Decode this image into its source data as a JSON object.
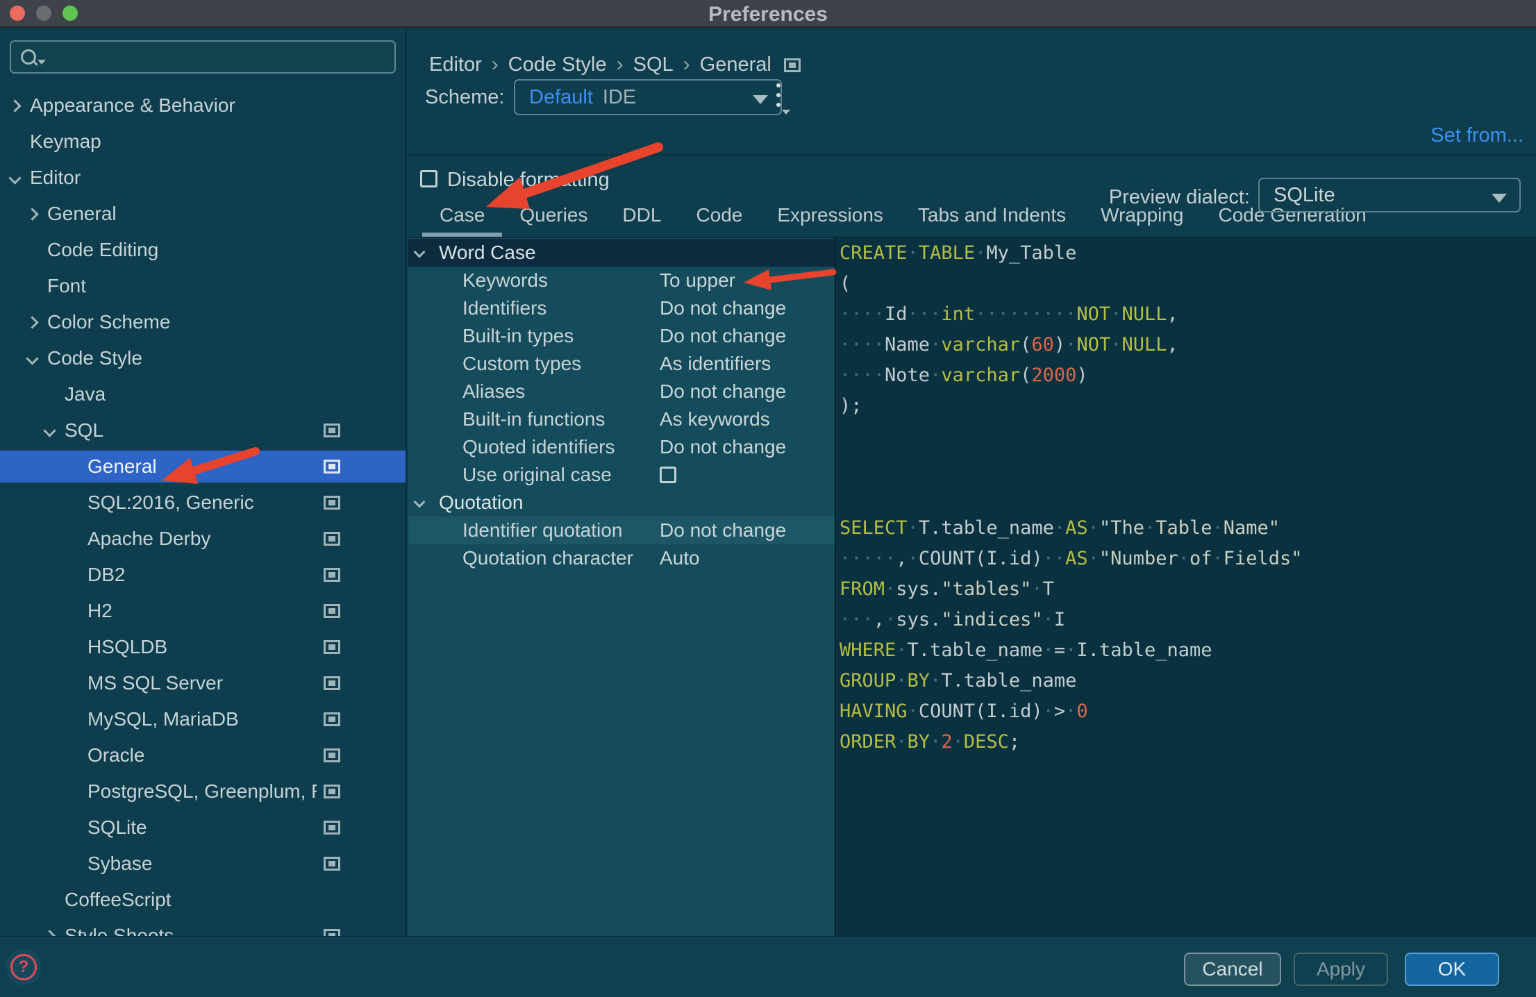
{
  "window": {
    "title": "Preferences",
    "traffic_lights": [
      "close",
      "minimize",
      "zoom"
    ]
  },
  "sidebar": {
    "search_value": "",
    "items": [
      {
        "label": "Appearance & Behavior",
        "level": 0,
        "chevron": "right",
        "icon": false,
        "selected": false
      },
      {
        "label": "Keymap",
        "level": 0,
        "chevron": null,
        "icon": false,
        "selected": false
      },
      {
        "label": "Editor",
        "level": 0,
        "chevron": "down",
        "icon": false,
        "selected": false
      },
      {
        "label": "General",
        "level": 1,
        "chevron": "right",
        "icon": false,
        "selected": false
      },
      {
        "label": "Code Editing",
        "level": 1,
        "chevron": null,
        "icon": false,
        "selected": false
      },
      {
        "label": "Font",
        "level": 1,
        "chevron": null,
        "icon": false,
        "selected": false
      },
      {
        "label": "Color Scheme",
        "level": 1,
        "chevron": "right",
        "icon": false,
        "selected": false
      },
      {
        "label": "Code Style",
        "level": 1,
        "chevron": "down",
        "icon": false,
        "selected": false
      },
      {
        "label": "Java",
        "level": 2,
        "chevron": null,
        "icon": false,
        "selected": false
      },
      {
        "label": "SQL",
        "level": 2,
        "chevron": "down",
        "icon": true,
        "selected": false
      },
      {
        "label": "General",
        "level": 3,
        "chevron": null,
        "icon": true,
        "selected": true
      },
      {
        "label": "SQL:2016, Generic",
        "level": 3,
        "chevron": null,
        "icon": true,
        "selected": false
      },
      {
        "label": "Apache Derby",
        "level": 3,
        "chevron": null,
        "icon": true,
        "selected": false
      },
      {
        "label": "DB2",
        "level": 3,
        "chevron": null,
        "icon": true,
        "selected": false
      },
      {
        "label": "H2",
        "level": 3,
        "chevron": null,
        "icon": true,
        "selected": false
      },
      {
        "label": "HSQLDB",
        "level": 3,
        "chevron": null,
        "icon": true,
        "selected": false
      },
      {
        "label": "MS SQL Server",
        "level": 3,
        "chevron": null,
        "icon": true,
        "selected": false
      },
      {
        "label": "MySQL, MariaDB",
        "level": 3,
        "chevron": null,
        "icon": true,
        "selected": false
      },
      {
        "label": "Oracle",
        "level": 3,
        "chevron": null,
        "icon": true,
        "selected": false
      },
      {
        "label": "PostgreSQL, Greenplum, Redshift",
        "level": 3,
        "chevron": null,
        "icon": true,
        "selected": false
      },
      {
        "label": "SQLite",
        "level": 3,
        "chevron": null,
        "icon": true,
        "selected": false
      },
      {
        "label": "Sybase",
        "level": 3,
        "chevron": null,
        "icon": true,
        "selected": false
      },
      {
        "label": "CoffeeScript",
        "level": 2,
        "chevron": null,
        "icon": false,
        "selected": false
      },
      {
        "label": "Style Sheets",
        "level": 2,
        "chevron": "right",
        "icon": true,
        "selected": false
      }
    ]
  },
  "header": {
    "breadcrumb": [
      "Editor",
      "Code Style",
      "SQL",
      "General"
    ],
    "scheme_label": "Scheme:",
    "scheme_value_primary": "Default",
    "scheme_value_secondary": "IDE",
    "set_from_label": "Set from..."
  },
  "content": {
    "disable_formatting_label": "Disable formatting",
    "disable_formatting_checked": false,
    "tabs": [
      {
        "label": "Case",
        "selected": true
      },
      {
        "label": "Queries",
        "selected": false
      },
      {
        "label": "DDL",
        "selected": false
      },
      {
        "label": "Code",
        "selected": false
      },
      {
        "label": "Expressions",
        "selected": false
      },
      {
        "label": "Tabs and Indents",
        "selected": false
      },
      {
        "label": "Wrapping",
        "selected": false
      },
      {
        "label": "Code Generation",
        "selected": false
      }
    ],
    "preview_dialect_label": "Preview dialect:",
    "preview_dialect_value": "SQLite",
    "settings": [
      {
        "kind": "group",
        "label": "Word Case",
        "state": "selected"
      },
      {
        "kind": "item",
        "label": "Keywords",
        "value": "To upper"
      },
      {
        "kind": "item",
        "label": "Identifiers",
        "value": "Do not change"
      },
      {
        "kind": "item",
        "label": "Built-in types",
        "value": "Do not change"
      },
      {
        "kind": "item",
        "label": "Custom types",
        "value": "As identifiers"
      },
      {
        "kind": "item",
        "label": "Aliases",
        "value": "Do not change"
      },
      {
        "kind": "item",
        "label": "Built-in functions",
        "value": "As keywords"
      },
      {
        "kind": "item",
        "label": "Quoted identifiers",
        "value": "Do not change"
      },
      {
        "kind": "item",
        "label": "Use original case",
        "checkbox": true,
        "checked": false
      },
      {
        "kind": "group",
        "label": "Quotation"
      },
      {
        "kind": "item",
        "label": "Identifier quotation",
        "value": "Do not change",
        "state": "highlighted"
      },
      {
        "kind": "item",
        "label": "Quotation character",
        "value": "Auto"
      }
    ],
    "code": {
      "lines": [
        [
          [
            "kw",
            "CREATE"
          ],
          [
            "ws",
            "·"
          ],
          [
            "kw",
            "TABLE"
          ],
          [
            "ws",
            "·"
          ],
          [
            "id",
            "My_Table"
          ]
        ],
        [
          [
            "id",
            "("
          ]
        ],
        [
          [
            "ws",
            "····"
          ],
          [
            "id",
            "Id"
          ],
          [
            "ws",
            "···"
          ],
          [
            "kw",
            "int"
          ],
          [
            "ws",
            "·········"
          ],
          [
            "kw",
            "NOT"
          ],
          [
            "ws",
            "·"
          ],
          [
            "kw",
            "NULL"
          ],
          [
            "id",
            ","
          ]
        ],
        [
          [
            "ws",
            "····"
          ],
          [
            "id",
            "Name"
          ],
          [
            "ws",
            "·"
          ],
          [
            "kw",
            "varchar"
          ],
          [
            "id",
            "("
          ],
          [
            "num",
            "60"
          ],
          [
            "id",
            ")"
          ],
          [
            "ws",
            "·"
          ],
          [
            "kw",
            "NOT"
          ],
          [
            "ws",
            "·"
          ],
          [
            "kw",
            "NULL"
          ],
          [
            "id",
            ","
          ]
        ],
        [
          [
            "ws",
            "····"
          ],
          [
            "id",
            "Note"
          ],
          [
            "ws",
            "·"
          ],
          [
            "kw",
            "varchar"
          ],
          [
            "id",
            "("
          ],
          [
            "num",
            "2000"
          ],
          [
            "id",
            ")"
          ]
        ],
        [
          [
            "id",
            ");"
          ]
        ],
        [],
        [],
        [],
        [
          [
            "kw",
            "SELECT"
          ],
          [
            "ws",
            "·"
          ],
          [
            "id",
            "T.table_name"
          ],
          [
            "ws",
            "·"
          ],
          [
            "kw",
            "AS"
          ],
          [
            "ws",
            "·"
          ],
          [
            "str",
            "\"The"
          ],
          [
            "ws",
            "·"
          ],
          [
            "str",
            "Table"
          ],
          [
            "ws",
            "·"
          ],
          [
            "str",
            "Name\""
          ]
        ],
        [
          [
            "ws",
            "·····"
          ],
          [
            "id",
            ","
          ],
          [
            "ws",
            "·"
          ],
          [
            "id",
            "COUNT(I.id)"
          ],
          [
            "ws",
            "··"
          ],
          [
            "kw",
            "AS"
          ],
          [
            "ws",
            "·"
          ],
          [
            "str",
            "\"Number"
          ],
          [
            "ws",
            "·"
          ],
          [
            "str",
            "of"
          ],
          [
            "ws",
            "·"
          ],
          [
            "str",
            "Fields\""
          ]
        ],
        [
          [
            "kw",
            "FROM"
          ],
          [
            "ws",
            "·"
          ],
          [
            "id",
            "sys."
          ],
          [
            "str",
            "\"tables\""
          ],
          [
            "ws",
            "·"
          ],
          [
            "id",
            "T"
          ]
        ],
        [
          [
            "ws",
            "···"
          ],
          [
            "id",
            ","
          ],
          [
            "ws",
            "·"
          ],
          [
            "id",
            "sys."
          ],
          [
            "str",
            "\"indices\""
          ],
          [
            "ws",
            "·"
          ],
          [
            "id",
            "I"
          ]
        ],
        [
          [
            "kw",
            "WHERE"
          ],
          [
            "ws",
            "·"
          ],
          [
            "id",
            "T.table_name"
          ],
          [
            "ws",
            "·"
          ],
          [
            "id",
            "="
          ],
          [
            "ws",
            "·"
          ],
          [
            "id",
            "I.table_name"
          ]
        ],
        [
          [
            "kw",
            "GROUP"
          ],
          [
            "ws",
            "·"
          ],
          [
            "kw",
            "BY"
          ],
          [
            "ws",
            "·"
          ],
          [
            "id",
            "T.table_name"
          ]
        ],
        [
          [
            "kw",
            "HAVING"
          ],
          [
            "ws",
            "·"
          ],
          [
            "id",
            "COUNT(I.id)"
          ],
          [
            "ws",
            "·"
          ],
          [
            "id",
            ">"
          ],
          [
            "ws",
            "·"
          ],
          [
            "num",
            "0"
          ]
        ],
        [
          [
            "kw",
            "ORDER"
          ],
          [
            "ws",
            "·"
          ],
          [
            "kw",
            "BY"
          ],
          [
            "ws",
            "·"
          ],
          [
            "num",
            "2"
          ],
          [
            "ws",
            "·"
          ],
          [
            "kw",
            "DESC"
          ],
          [
            "id",
            ";"
          ]
        ]
      ]
    }
  },
  "footer": {
    "help_glyph": "?",
    "buttons": [
      {
        "label": "Cancel",
        "variant": "cancel",
        "disabled": false
      },
      {
        "label": "Apply",
        "variant": "apply",
        "disabled": true
      },
      {
        "label": "OK",
        "variant": "ok",
        "disabled": false,
        "primary": true
      }
    ]
  },
  "annotations": {
    "arrow_color": "#E8432D",
    "arrows": [
      "points-at-case-tab",
      "points-at-keywords-to-upper",
      "points-at-sidebar-general"
    ]
  },
  "colors": {
    "selection_blue": "#2E64C5",
    "link_blue": "#3E8FF2",
    "ok_button_blue": "#15659F",
    "arrow_red": "#E8432D",
    "sidebar_bg": "#0E3D4D",
    "settings_bg": "#144C5B",
    "code_bg": "#0A3140",
    "code_keyword": "#B5BD42",
    "code_number": "#DD6848",
    "code_text": "#C3CDD0",
    "traffic_red": "#ED6A5E",
    "traffic_gray": "#686D71",
    "traffic_green": "#61C554"
  }
}
